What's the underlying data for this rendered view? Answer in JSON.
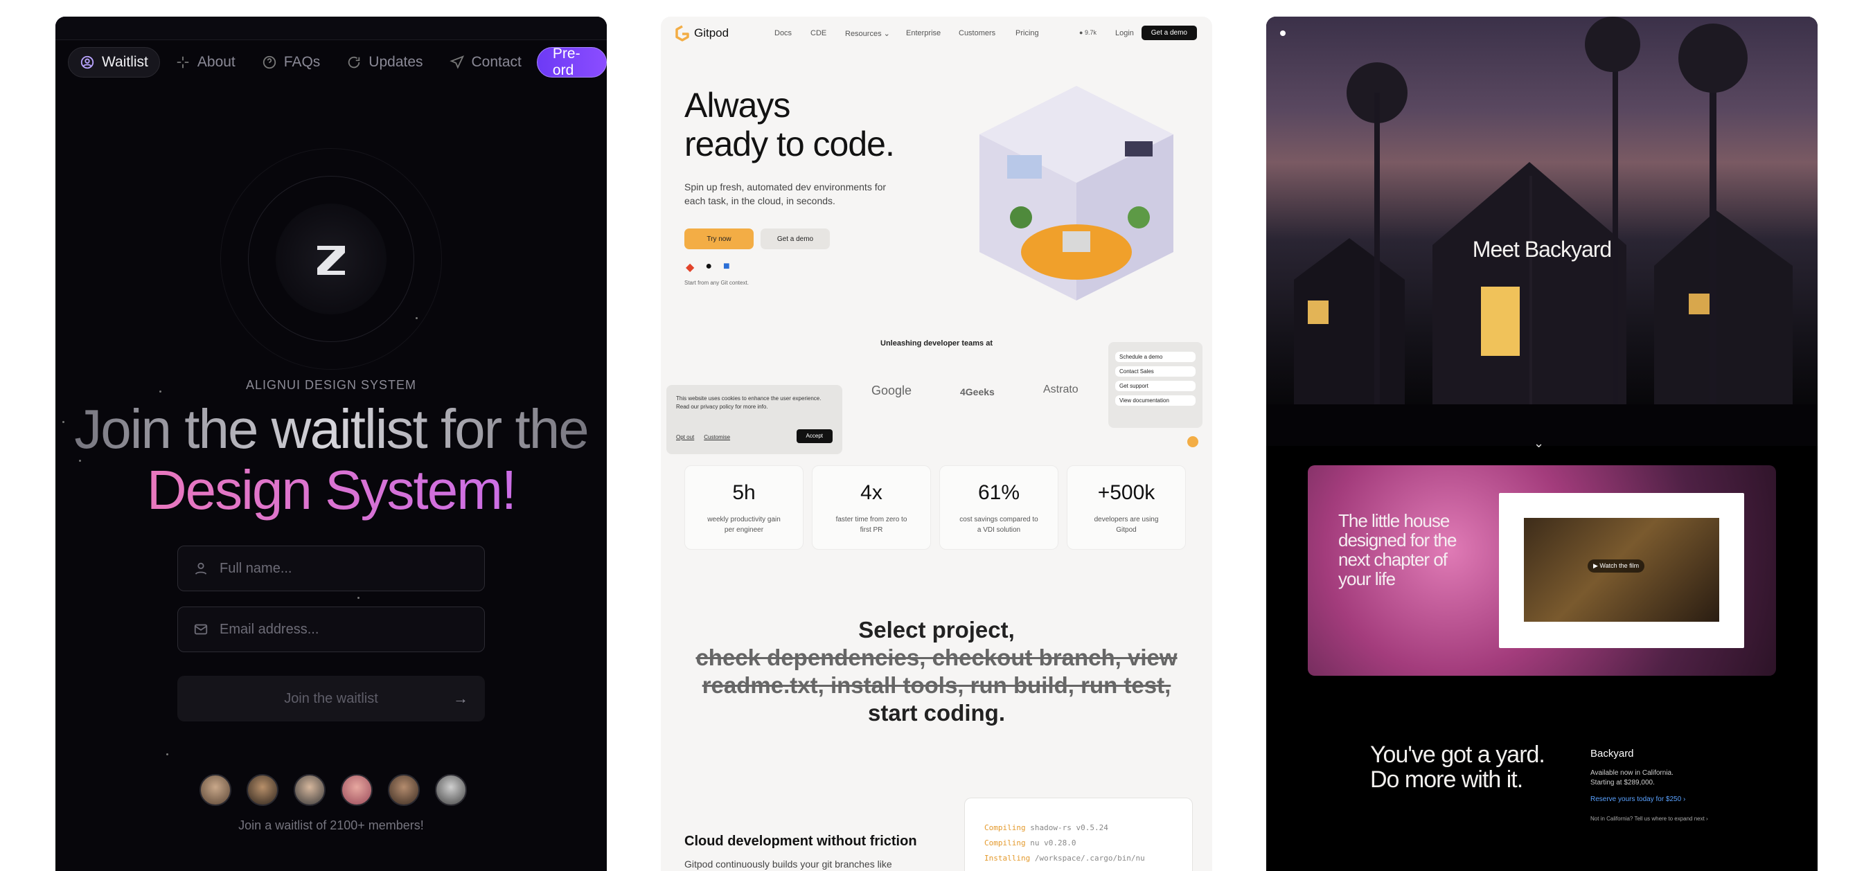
{
  "alignui": {
    "nav": [
      {
        "label": "Waitlist",
        "icon": "user-circle-icon",
        "active": true
      },
      {
        "label": "About",
        "icon": "sparkle-icon",
        "active": false
      },
      {
        "label": "FAQs",
        "icon": "question-icon",
        "active": false
      },
      {
        "label": "Updates",
        "icon": "refresh-icon",
        "active": false
      },
      {
        "label": "Contact",
        "icon": "send-icon",
        "active": false
      }
    ],
    "preorder_label": "Pre-ord",
    "eyebrow": "ALIGNUI DESIGN SYSTEM",
    "headline_line1": "Join the waitlist for the",
    "headline_line2": "Design System!",
    "fullname_placeholder": "Full name...",
    "email_placeholder": "Email address...",
    "join_label": "Join the waitlist",
    "members_text": "Join a waitlist of 2100+ members!",
    "colors": {
      "accent": "#7b45ff",
      "pink": "#f07ab3",
      "background": "#07060b"
    }
  },
  "gitpod": {
    "brand": "Gitpod",
    "nav": [
      "Docs",
      "CDE",
      "Resources",
      "Enterprise",
      "Customers",
      "Pricing"
    ],
    "stars": "9.7k",
    "login": "Login",
    "demo": "Get a demo",
    "hero_line1": "Always",
    "hero_line2": "ready to code.",
    "hero_sub": "Spin up fresh, automated dev environments for each task, in the cloud, in seconds.",
    "try_now": "Try now",
    "get_demo": "Get a demo",
    "start_hint": "Start from any Git context.",
    "unleashing": "Unleashing developer teams at",
    "cookie_text": "This website uses cookies to enhance the user experience. Read our privacy policy for more info.",
    "cookie_optout": "Opt out",
    "cookie_customise": "Customise",
    "cookie_accept": "Accept",
    "brands": [
      "Google",
      "4Geeks",
      "Astrato"
    ],
    "helper": [
      "Schedule a demo",
      "Contact Sales",
      "Get support",
      "View documentation"
    ],
    "stats": [
      {
        "num": "5h",
        "label": "weekly productivity gain per engineer"
      },
      {
        "num": "4x",
        "label": "faster time from zero to first PR"
      },
      {
        "num": "61%",
        "label": "cost savings compared to a VDI solution"
      },
      {
        "num": "+500k",
        "label": "developers are using Gitpod"
      }
    ],
    "select_line1": "Select project,",
    "select_strike1": "check dependencies, checkout branch, view",
    "select_strike2": "readme.txt, install tools, run build, run test,",
    "select_line3": "start coding.",
    "cloud_heading": "Cloud development without friction",
    "cloud_text": "Gitpod continuously builds your git branches like",
    "terminal": [
      {
        "verb": "Compiling",
        "rest": "shadow-rs v0.5.24"
      },
      {
        "verb": "Compiling",
        "rest": "nu v0.28.0"
      },
      {
        "verb": "Installing",
        "rest": "/workspace/.cargo/bin/nu"
      }
    ]
  },
  "backyard": {
    "meet": "Meet Backyard",
    "tagline": "The little house designed for the next chapter of your life",
    "watch": "Watch the film",
    "yard_line1": "You've got a yard.",
    "yard_line2": "Do more with it.",
    "info_name": "Backyard",
    "info_line1": "Available now in California.",
    "info_line2": "Starting at $289,000.",
    "info_reserve": "Reserve yours today for $250 ›",
    "info_small": "Not in California?  Tell us where to expand next ›"
  }
}
